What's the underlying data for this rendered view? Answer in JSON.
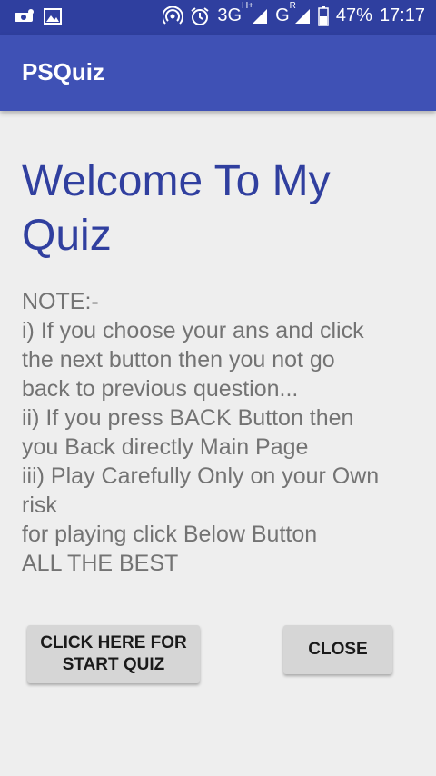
{
  "status_bar": {
    "network_3g": "3G",
    "network_3g_sup": "H+",
    "network_g": "G",
    "network_g_sup": "R",
    "battery_percent": "47%",
    "clock": "17:17",
    "icons": [
      "notification-icon",
      "image-icon",
      "hotspot-icon",
      "alarm-icon",
      "signal-icon",
      "signal-icon",
      "battery-icon"
    ]
  },
  "app_bar": {
    "title": "PSQuiz"
  },
  "main": {
    "welcome": "Welcome To My Quiz",
    "notes": [
      "NOTE:-",
      "i) If you choose your ans and click",
      "the next button then you not go",
      "back to previous question...",
      "ii) If you press BACK Button then",
      "you Back directly Main Page",
      "iii) Play Carefully Only on your Own",
      "risk",
      "for playing click Below Button",
      "ALL THE BEST"
    ]
  },
  "buttons": {
    "start_line1": "CLICK HERE FOR",
    "start_line2": "START QUIZ",
    "close": "CLOSE"
  },
  "colors": {
    "status_bar": "#2f3f9f",
    "app_bar": "#3f51b5",
    "welcome_text": "#303f9f",
    "note_text": "#737373",
    "button_bg": "#d6d6d6",
    "page_bg": "#eeeeee"
  }
}
